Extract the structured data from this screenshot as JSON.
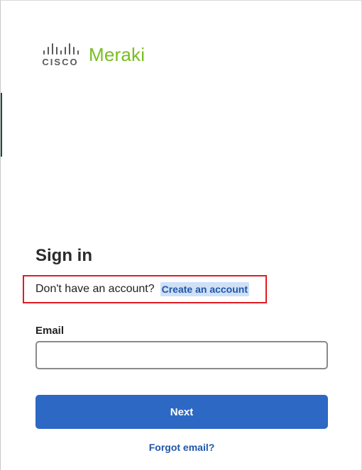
{
  "brand": {
    "cisco_label": "CISCO",
    "product_label": "Meraki",
    "cisco_color": "#5a5a5a",
    "meraki_color": "#78be20",
    "cisco_icon": "cisco-bars-icon"
  },
  "form": {
    "title": "Sign in",
    "no_account_text": "Don't have an account?",
    "create_account_label": "Create an account",
    "email_label": "Email",
    "email_value": "",
    "email_placeholder": "",
    "next_label": "Next",
    "forgot_label": "Forgot email?"
  },
  "colors": {
    "primary": "#2d68c4",
    "link": "#1f56a8",
    "highlight_border": "#e11b22"
  }
}
